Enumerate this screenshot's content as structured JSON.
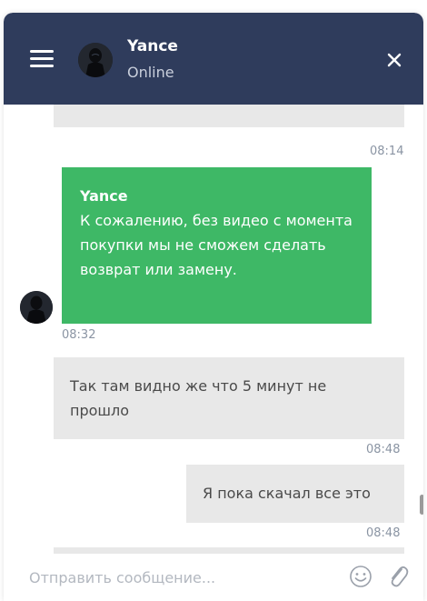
{
  "header": {
    "agent_name": "Yance",
    "agent_status": "Online",
    "menu_icon": "hamburger-menu-icon",
    "close_icon": "close-x-icon",
    "background_color": "#2f3c5c"
  },
  "messages": [
    {
      "from": "visitor",
      "text": "",
      "time": "08:14"
    },
    {
      "from": "agent",
      "sender": "Yance",
      "text": "К сожалению, без видео с момента покупки мы не сможем сделать возврат или замену.",
      "time": "08:32"
    },
    {
      "from": "visitor",
      "text": "Так там видно же что 5 минут не прошло",
      "time": "08:48"
    },
    {
      "from": "visitor",
      "text": "Я пока скачал все это",
      "time": "08:48"
    },
    {
      "from": "visitor",
      "text": "",
      "time": ""
    }
  ],
  "composer": {
    "placeholder": "Отправить сообщение...",
    "value": "",
    "emoji_icon": "smiley-face-icon",
    "attach_icon": "paperclip-icon"
  },
  "colors": {
    "agent_bubble": "#3eb866",
    "visitor_bubble": "#e8e8e8",
    "timestamp": "#8a94a3"
  }
}
